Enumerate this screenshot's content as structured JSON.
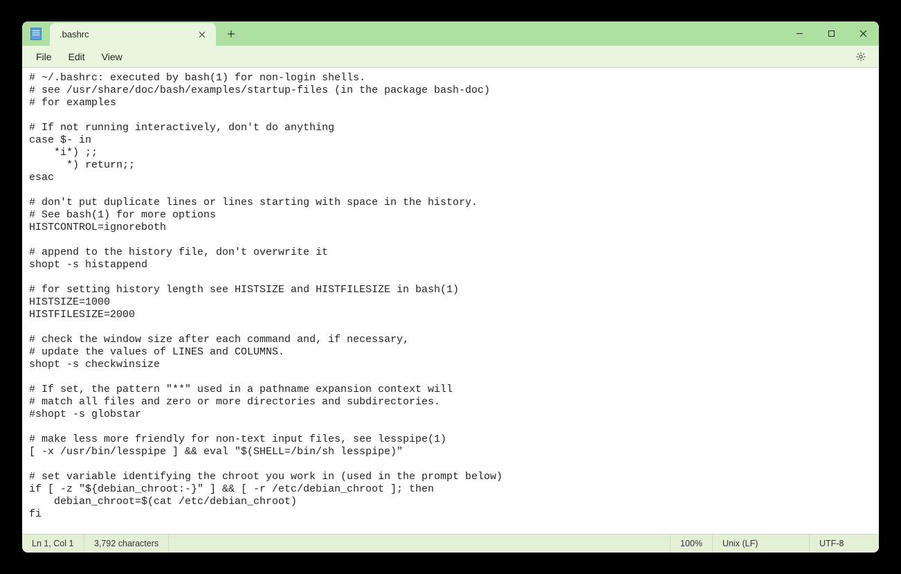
{
  "tab": {
    "title": ".bashrc"
  },
  "menu": {
    "file": "File",
    "edit": "Edit",
    "view": "View"
  },
  "editor": {
    "content": "# ~/.bashrc: executed by bash(1) for non-login shells.\n# see /usr/share/doc/bash/examples/startup-files (in the package bash-doc)\n# for examples\n\n# If not running interactively, don't do anything\ncase $- in\n    *i*) ;;\n      *) return;;\nesac\n\n# don't put duplicate lines or lines starting with space in the history.\n# See bash(1) for more options\nHISTCONTROL=ignoreboth\n\n# append to the history file, don't overwrite it\nshopt -s histappend\n\n# for setting history length see HISTSIZE and HISTFILESIZE in bash(1)\nHISTSIZE=1000\nHISTFILESIZE=2000\n\n# check the window size after each command and, if necessary,\n# update the values of LINES and COLUMNS.\nshopt -s checkwinsize\n\n# If set, the pattern \"**\" used in a pathname expansion context will\n# match all files and zero or more directories and subdirectories.\n#shopt -s globstar\n\n# make less more friendly for non-text input files, see lesspipe(1)\n[ -x /usr/bin/lesspipe ] && eval \"$(SHELL=/bin/sh lesspipe)\"\n\n# set variable identifying the chroot you work in (used in the prompt below)\nif [ -z \"${debian_chroot:-}\" ] && [ -r /etc/debian_chroot ]; then\n    debian_chroot=$(cat /etc/debian_chroot)\nfi"
  },
  "status": {
    "position": "Ln 1, Col 1",
    "chars": "3,792 characters",
    "zoom": "100%",
    "lineending": "Unix (LF)",
    "encoding": "UTF-8"
  }
}
